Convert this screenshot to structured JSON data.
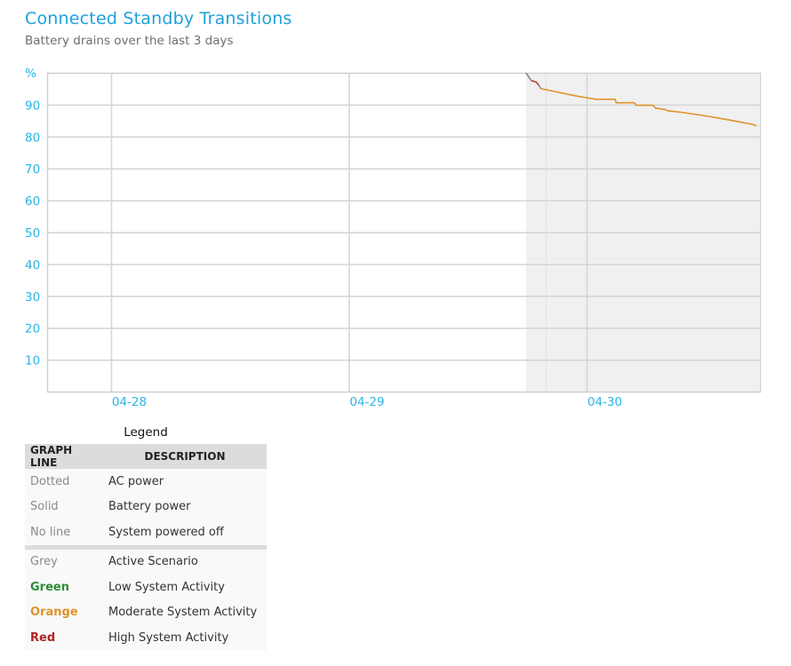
{
  "header": {
    "title": "Connected Standby Transitions",
    "subtitle": "Battery drains over the last 3 days"
  },
  "chart_data": {
    "type": "line",
    "title": "Connected Standby Transitions",
    "subtitle": "Battery drains over the last 3 days",
    "ylabel": "%",
    "xlabel": "",
    "ylim": [
      0,
      100
    ],
    "yticks": [
      10,
      20,
      30,
      40,
      50,
      60,
      70,
      80,
      90
    ],
    "xlim_days": [
      -0.27,
      2.73
    ],
    "xticks": [
      {
        "label": "04-28",
        "day": 0
      },
      {
        "label": "04-29",
        "day": 1
      },
      {
        "label": "04-30",
        "day": 2
      }
    ],
    "grid": true,
    "shaded_region_days": [
      1.745,
      2.725
    ],
    "inner_shaded_start_day": 1.83,
    "series": [
      {
        "name": "Active Scenario",
        "color": "#8a8a8a",
        "style": "solid",
        "points": [
          [
            1.745,
            100
          ],
          [
            1.768,
            97.5
          ]
        ]
      },
      {
        "name": "High System Activity",
        "color": "#c0392b",
        "style": "solid",
        "points": [
          [
            1.768,
            97.5
          ],
          [
            1.775,
            97.4
          ],
          [
            1.79,
            97.0
          ],
          [
            1.797,
            96.3
          ],
          [
            1.8,
            96.0
          ]
        ]
      },
      {
        "name": "Active Scenario",
        "color": "#8a8a8a",
        "style": "solid",
        "points": [
          [
            1.8,
            96.0
          ],
          [
            1.808,
            95.0
          ]
        ]
      },
      {
        "name": "Moderate System Activity",
        "color": "#e0922a",
        "style": "solid",
        "points": [
          [
            1.808,
            95.0
          ],
          [
            1.85,
            94.4
          ],
          [
            1.9,
            93.6
          ],
          [
            1.95,
            92.8
          ],
          [
            2.0,
            92.2
          ],
          [
            2.04,
            91.7
          ],
          [
            2.12,
            91.7
          ],
          [
            2.125,
            90.6
          ],
          [
            2.2,
            90.6
          ],
          [
            2.21,
            89.8
          ],
          [
            2.28,
            89.8
          ],
          [
            2.29,
            88.9
          ],
          [
            2.33,
            88.5
          ],
          [
            2.34,
            88.1
          ],
          [
            2.4,
            87.6
          ],
          [
            2.5,
            86.5
          ],
          [
            2.6,
            85.2
          ],
          [
            2.7,
            83.8
          ],
          [
            2.715,
            83.4
          ]
        ]
      }
    ]
  },
  "legend": {
    "title": "Legend",
    "headers": [
      "GRAPH LINE",
      "DESCRIPTION"
    ],
    "line_styles": [
      {
        "key": "Dotted",
        "desc": "AC power"
      },
      {
        "key": "Solid",
        "desc": "Battery power"
      },
      {
        "key": "No line",
        "desc": "System powered off"
      }
    ],
    "colors": [
      {
        "key": "Grey",
        "desc": "Active Scenario",
        "color": "#8a8a8a"
      },
      {
        "key": "Green",
        "desc": "Low System Activity",
        "color": "#2e8b35"
      },
      {
        "key": "Orange",
        "desc": "Moderate System Activity",
        "color": "#e0922a"
      },
      {
        "key": "Red",
        "desc": "High System Activity",
        "color": "#b22222"
      }
    ]
  }
}
